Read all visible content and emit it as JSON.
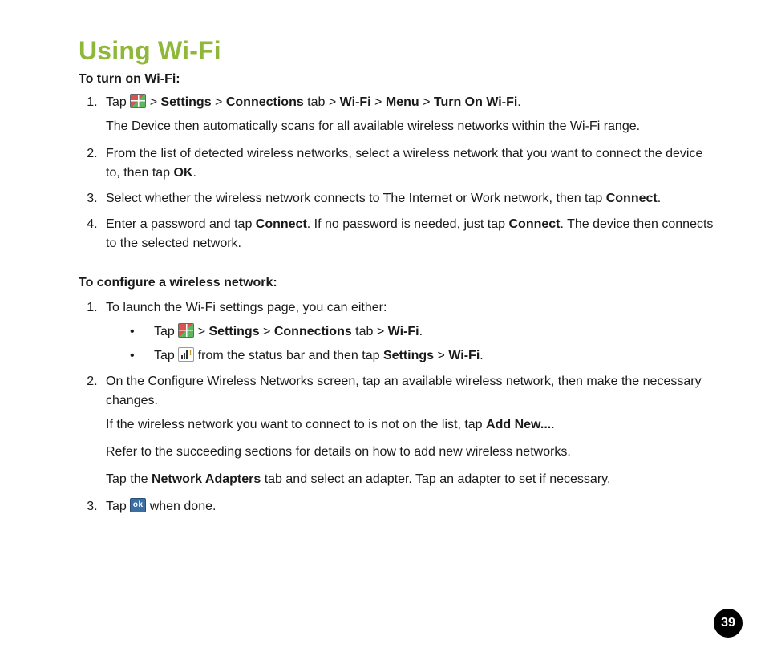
{
  "title": "Using Wi-Fi",
  "sectionA": {
    "heading": "To turn on Wi-Fi:",
    "step1": {
      "pre": "Tap ",
      "gt1": " > ",
      "settings": "Settings",
      "gt2": " > ",
      "connections": "Connections",
      "tab": " tab > ",
      "wifi": "Wi-Fi",
      "gt3": " > ",
      "menu": "Menu",
      "gt4": " > ",
      "turnon": "Turn On Wi-Fi",
      "dot": "."
    },
    "step1b": "The Device then automatically scans for all available wireless networks within the Wi-Fi range.",
    "step2a": "From the list of detected wireless networks, select a wireless network that you want to connect the device to, then tap ",
    "step2b": "OK",
    "step2c": ".",
    "step3a": "Select whether the wireless network connects to The Internet or Work network, then tap ",
    "step3b": "Connect",
    "step3c": ".",
    "step4a": "Enter a password and tap ",
    "step4b": "Connect",
    "step4c": ". If no password is needed, just tap ",
    "step4d": "Connect",
    "step4e": ". The device then connects to the selected network."
  },
  "sectionB": {
    "heading": "To configure a wireless network:",
    "step1": "To launch the Wi-Fi settings page, you can either:",
    "b1": {
      "pre": "Tap ",
      "gt1": " > ",
      "settings": "Settings",
      "gt2": " > ",
      "connections": "Connections",
      "tab": " tab > ",
      "wifi": "Wi-Fi",
      "dot": "."
    },
    "b2": {
      "pre": "Tap ",
      "post": " from the status bar and then tap ",
      "settings": "Settings",
      "gt": " > ",
      "wifi": "Wi-Fi",
      "dot": "."
    },
    "step2": "On the Configure Wireless Networks screen, tap an available wireless network, then make the necessary changes.",
    "step2b_a": "If the wireless network you want to connect to is not on the list, tap ",
    "step2b_b": "Add New...",
    "step2b_c": ".",
    "step2c": "Refer to the succeeding sections for details on how to add new wireless networks.",
    "step2d_a": "Tap the ",
    "step2d_b": "Network Adapters",
    "step2d_c": " tab and select an adapter. Tap an adapter to set if necessary.",
    "step3a": "Tap ",
    "step3b": " when done."
  },
  "pageNumber": "39"
}
